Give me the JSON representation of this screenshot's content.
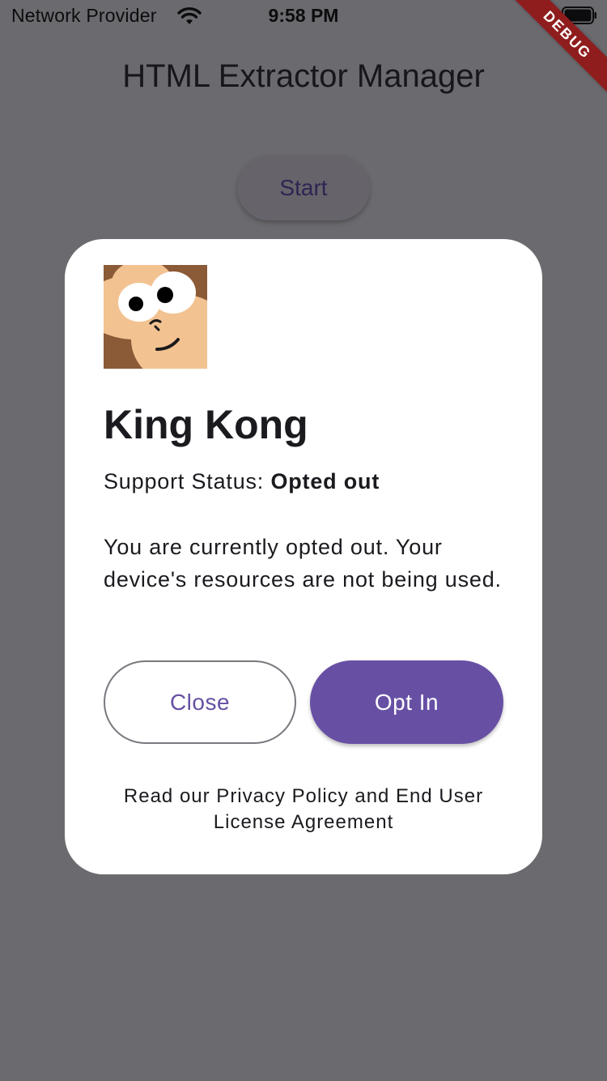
{
  "status_bar": {
    "carrier": "Network Provider",
    "time": "9:58 PM",
    "wifi_icon": "wifi-icon",
    "battery_icon": "battery-icon"
  },
  "debug_banner": "DEBUG",
  "app_bar": {
    "title": "HTML Extractor Manager"
  },
  "main": {
    "start_label": "Start"
  },
  "dialog": {
    "avatar_icon": "monkey-avatar",
    "title": "King Kong",
    "support_status_label": "Support Status:",
    "support_status_value": "Opted out",
    "message": "You are currently opted out. Your device's resources are not being used.",
    "close_label": "Close",
    "optin_label": "Opt In",
    "legal_text": "Read our Privacy Policy and End User License Agreement"
  },
  "colors": {
    "scrim_background": "#6b6a6e",
    "accent": "#6750a4",
    "debug_ribbon": "#8f1d1d",
    "avatar_background": "#8b5a36",
    "avatar_face": "#f2c291"
  }
}
